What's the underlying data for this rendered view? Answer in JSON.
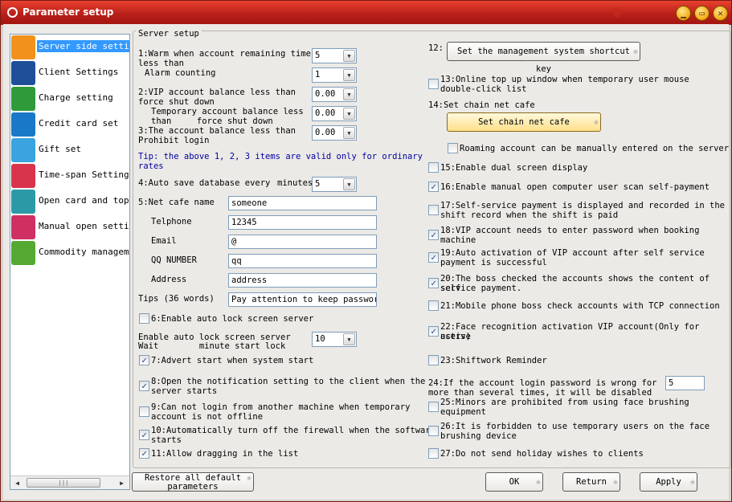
{
  "window": {
    "title": "Parameter setup",
    "minimize": "▁",
    "maximize": "▭",
    "close": "✕"
  },
  "sidebar": {
    "items": [
      {
        "label": "Server side setting",
        "icon": "server-icon",
        "color": "#f2921d"
      },
      {
        "label": "Client Settings",
        "icon": "monitor-icon",
        "color": "#1f4f99"
      },
      {
        "label": "Charge setting",
        "icon": "charge-icon",
        "color": "#2f9a3a"
      },
      {
        "label": "Credit card set",
        "icon": "credit-card-icon",
        "color": "#1a78c8"
      },
      {
        "label": "Gift set",
        "icon": "gift-icon",
        "color": "#3aa3e0"
      },
      {
        "label": "Time-span Setting",
        "icon": "clock-icon",
        "color": "#d8344b"
      },
      {
        "label": "Open card and top up",
        "icon": "id-card-icon",
        "color": "#2b9aa6"
      },
      {
        "label": "Manual open setting",
        "icon": "hand-pointer-icon",
        "color": "#d02f61"
      },
      {
        "label": "Commodity management",
        "icon": "cart-icon",
        "color": "#55a932"
      }
    ],
    "scroll_left": "◀",
    "scroll_right": "▶",
    "scroll_thumb": "|||"
  },
  "group_title": "Server setup",
  "left": {
    "warn_line1": "1:Warm when account remaining time",
    "warn_line2": "less than",
    "warn_value": "5",
    "alarm_label": "Alarm counting",
    "alarm_value": "1",
    "vip_line1": "2:VIP account balance less than",
    "vip_line2": "force shut down",
    "vip_value": "0.00",
    "temp_line1": "Temporary account balance less",
    "temp_line2": "than     force shut down",
    "temp_value": "0.00",
    "prohibit_line1": "3:The account balance less than",
    "prohibit_line2": "Prohibit login",
    "prohibit_value": "0.00",
    "tip_line1": "Tip: the above 1, 2, 3 items are valid only for ordinary",
    "tip_line2": "rates",
    "autosave_label": "4:Auto save database every",
    "autosave_unit": "minutes",
    "autosave_value": "5",
    "cafe_name_label": "5:Net cafe name",
    "cafe_name_value": "someone",
    "telphone_label": "Telphone",
    "telphone_value": "12345",
    "email_label": "Email",
    "email_value": "@",
    "qq_label": "QQ NUMBER",
    "qq_value": "qq",
    "address_label": "Address",
    "address_value": "address",
    "tips_label": "Tips (36 words)",
    "tips_value": "Pay attention to keep password",
    "opt6": "6:Enable auto lock screen server",
    "lock_line1": "Enable auto lock screen server",
    "lock_line2": "Wait        minute start lock",
    "lock_value": "10",
    "opt7": "7:Advert start when system start",
    "opt8_line1": "8:Open the notification setting to the client when the",
    "opt8_line2": "server starts",
    "opt9_line1": "9:Can not login from another machine when temporary",
    "opt9_line2": "account is not offline",
    "opt10_line1": "10:Automatically turn off the firewall when the software",
    "opt10_line2": "starts",
    "opt11": "11:Allow dragging in the list"
  },
  "right": {
    "opt12_label": "12:",
    "opt12_button": "Set the management system shortcut key",
    "opt13_line1": "13:Online top up window when temporary user mouse",
    "opt13_line2": "double-click list",
    "opt14_label": "14:Set chain net cafe",
    "opt14_button": "Set chain net cafe",
    "roaming": "Roaming account can be manually entered on the server",
    "opt15": "15:Enable dual screen display",
    "opt16": "16:Enable manual open computer user scan self-payment",
    "opt17_line1": "17:Self-service payment is displayed and recorded in the",
    "opt17_line2": "shift record when the shift is paid",
    "opt18_line1": "18:VIP account needs to enter password when booking",
    "opt18_line2": "machine",
    "opt19_line1": "19:Auto activation of VIP account after self service",
    "opt19_line2": "payment is successful",
    "opt20_line1": "20:The boss checked the accounts shows the content of self",
    "opt20_line2": "service payment.",
    "opt21": "21:Mobile phone boss check accounts with TCP connection",
    "opt22_line1": "22:Face recognition activation VIP account(Only for active",
    "opt22_line2": "users)",
    "opt23": "23:Shiftwork Reminder",
    "opt24_line1": "24:If the account login password is wrong for",
    "opt24_line2": "more than several times, it will be disabled",
    "opt24_value": "5",
    "opt25_line1": "25:Minors are prohibited from using face brushing",
    "opt25_line2": "equipment",
    "opt26_line1": "26:It is forbidden to use temporary users on the face",
    "opt26_line2": "brushing device",
    "opt27": "27:Do not send holiday wishes to clients"
  },
  "footer": {
    "restore_line1": "Restore all default",
    "restore_line2": "parameters",
    "ok": "OK",
    "return": "Return",
    "apply": "Apply"
  },
  "check": "✓",
  "drop": "▼",
  "btn_deco": "❀"
}
